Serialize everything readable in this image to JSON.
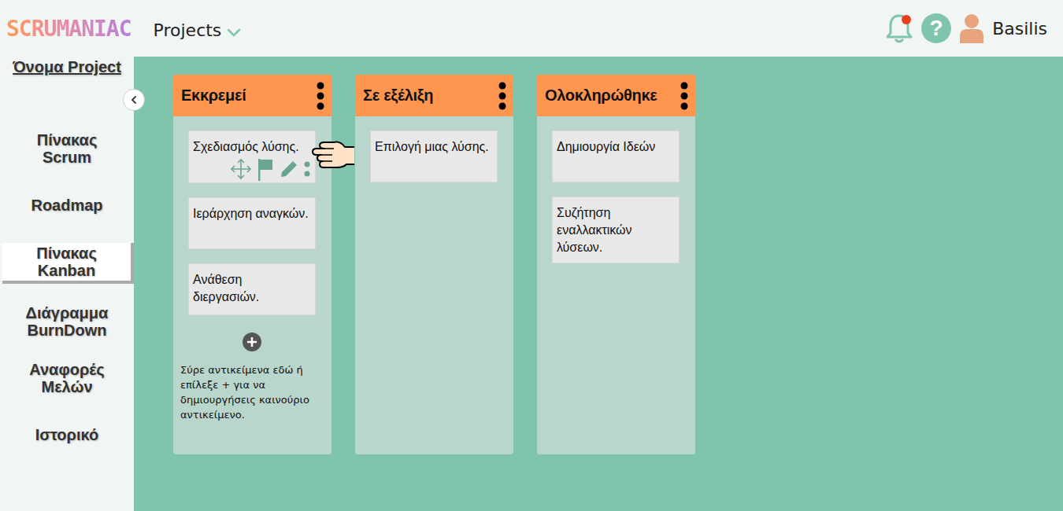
{
  "app": {
    "logo": "SCRUMANIAC",
    "menu": "Projects",
    "user": "Basilis",
    "help": "?",
    "notifications": true
  },
  "sidebar": {
    "project": "Όνομα Project",
    "items": [
      {
        "label": "Πίνακας Scrum",
        "selected": false
      },
      {
        "label": "Roadmap",
        "selected": false
      },
      {
        "label": "Πίνακας Kanban",
        "selected": true
      },
      {
        "label": "Διάγραμμα BurnDown",
        "selected": false
      },
      {
        "label": "Αναφορές Μελών",
        "selected": false
      },
      {
        "label": "Ιστορικό",
        "selected": false
      }
    ]
  },
  "columns": [
    {
      "title": "Εκκρεμεί",
      "addable": true,
      "hint": "Σύρε αντικείμενα εδώ ή επίλεξε + για να δημιουργήσεις καινούριο αντικείμενο.",
      "cards": [
        {
          "text": "Σχεδιασμός λύσης.",
          "hovered": true
        },
        {
          "text": "Ιεράρχηση αναγκών.",
          "hovered": false
        },
        {
          "text": "Ανάθεση διεργασιών.",
          "hovered": false
        }
      ]
    },
    {
      "title": "Σε εξέλιξη",
      "addable": false,
      "hint": "",
      "cards": [
        {
          "text": "Επιλογή μιας λύσης.",
          "hovered": false
        }
      ]
    },
    {
      "title": "Ολοκληρώθηκε",
      "addable": false,
      "hint": "",
      "cards": [
        {
          "text": "Δημιουργία Ιδεών",
          "hovered": false
        },
        {
          "text": "Συζήτηση εναλλακτικών λύσεων.",
          "hovered": false
        }
      ]
    }
  ]
}
